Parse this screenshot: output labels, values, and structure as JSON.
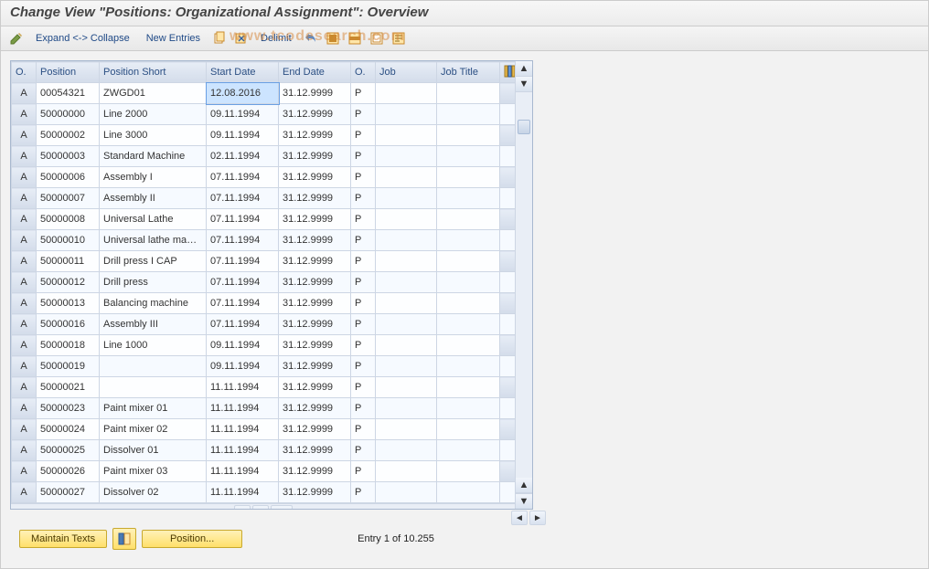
{
  "title": "Change View \"Positions: Organizational Assignment\": Overview",
  "watermark": "www.tcodesearch.com",
  "toolbar": {
    "expand_collapse": "Expand <-> Collapse",
    "new_entries": "New Entries",
    "delimit": "Delimit"
  },
  "columns": {
    "o": "O.",
    "position": "Position",
    "position_short": "Position Short",
    "start_date": "Start Date",
    "end_date": "End Date",
    "o2": "O.",
    "job": "Job",
    "job_title": "Job Title"
  },
  "rows": [
    {
      "o": "A",
      "position": "00054321",
      "short": "ZWGD01",
      "start": "12.08.2016",
      "end": "31.12.9999",
      "o2": "P",
      "job": "",
      "title": ""
    },
    {
      "o": "A",
      "position": "50000000",
      "short": "Line 2000",
      "start": "09.11.1994",
      "end": "31.12.9999",
      "o2": "P",
      "job": "",
      "title": ""
    },
    {
      "o": "A",
      "position": "50000002",
      "short": "Line 3000",
      "start": "09.11.1994",
      "end": "31.12.9999",
      "o2": "P",
      "job": "",
      "title": ""
    },
    {
      "o": "A",
      "position": "50000003",
      "short": "Standard Machine",
      "start": "02.11.1994",
      "end": "31.12.9999",
      "o2": "P",
      "job": "",
      "title": ""
    },
    {
      "o": "A",
      "position": "50000006",
      "short": "Assembly I",
      "start": "07.11.1994",
      "end": "31.12.9999",
      "o2": "P",
      "job": "",
      "title": ""
    },
    {
      "o": "A",
      "position": "50000007",
      "short": "Assembly II",
      "start": "07.11.1994",
      "end": "31.12.9999",
      "o2": "P",
      "job": "",
      "title": ""
    },
    {
      "o": "A",
      "position": "50000008",
      "short": "Universal Lathe",
      "start": "07.11.1994",
      "end": "31.12.9999",
      "o2": "P",
      "job": "",
      "title": ""
    },
    {
      "o": "A",
      "position": "50000010",
      "short": "Universal lathe ma…",
      "start": "07.11.1994",
      "end": "31.12.9999",
      "o2": "P",
      "job": "",
      "title": ""
    },
    {
      "o": "A",
      "position": "50000011",
      "short": "Drill press I CAP",
      "start": "07.11.1994",
      "end": "31.12.9999",
      "o2": "P",
      "job": "",
      "title": ""
    },
    {
      "o": "A",
      "position": "50000012",
      "short": "Drill press",
      "start": "07.11.1994",
      "end": "31.12.9999",
      "o2": "P",
      "job": "",
      "title": ""
    },
    {
      "o": "A",
      "position": "50000013",
      "short": "Balancing machine",
      "start": "07.11.1994",
      "end": "31.12.9999",
      "o2": "P",
      "job": "",
      "title": ""
    },
    {
      "o": "A",
      "position": "50000016",
      "short": "Assembly III",
      "start": "07.11.1994",
      "end": "31.12.9999",
      "o2": "P",
      "job": "",
      "title": ""
    },
    {
      "o": "A",
      "position": "50000018",
      "short": "Line 1000",
      "start": "09.11.1994",
      "end": "31.12.9999",
      "o2": "P",
      "job": "",
      "title": ""
    },
    {
      "o": "A",
      "position": "50000019",
      "short": "",
      "start": "09.11.1994",
      "end": "31.12.9999",
      "o2": "P",
      "job": "",
      "title": ""
    },
    {
      "o": "A",
      "position": "50000021",
      "short": "",
      "start": "11.11.1994",
      "end": "31.12.9999",
      "o2": "P",
      "job": "",
      "title": ""
    },
    {
      "o": "A",
      "position": "50000023",
      "short": "Paint mixer 01",
      "start": "11.11.1994",
      "end": "31.12.9999",
      "o2": "P",
      "job": "",
      "title": ""
    },
    {
      "o": "A",
      "position": "50000024",
      "short": "Paint mixer 02",
      "start": "11.11.1994",
      "end": "31.12.9999",
      "o2": "P",
      "job": "",
      "title": ""
    },
    {
      "o": "A",
      "position": "50000025",
      "short": "Dissolver 01",
      "start": "11.11.1994",
      "end": "31.12.9999",
      "o2": "P",
      "job": "",
      "title": ""
    },
    {
      "o": "A",
      "position": "50000026",
      "short": "Paint mixer 03",
      "start": "11.11.1994",
      "end": "31.12.9999",
      "o2": "P",
      "job": "",
      "title": ""
    },
    {
      "o": "A",
      "position": "50000027",
      "short": "Dissolver 02",
      "start": "11.11.1994",
      "end": "31.12.9999",
      "o2": "P",
      "job": "",
      "title": ""
    }
  ],
  "footer": {
    "maintain_texts": "Maintain Texts",
    "position_btn": "Position...",
    "entry_label": "Entry 1 of 10.255"
  }
}
